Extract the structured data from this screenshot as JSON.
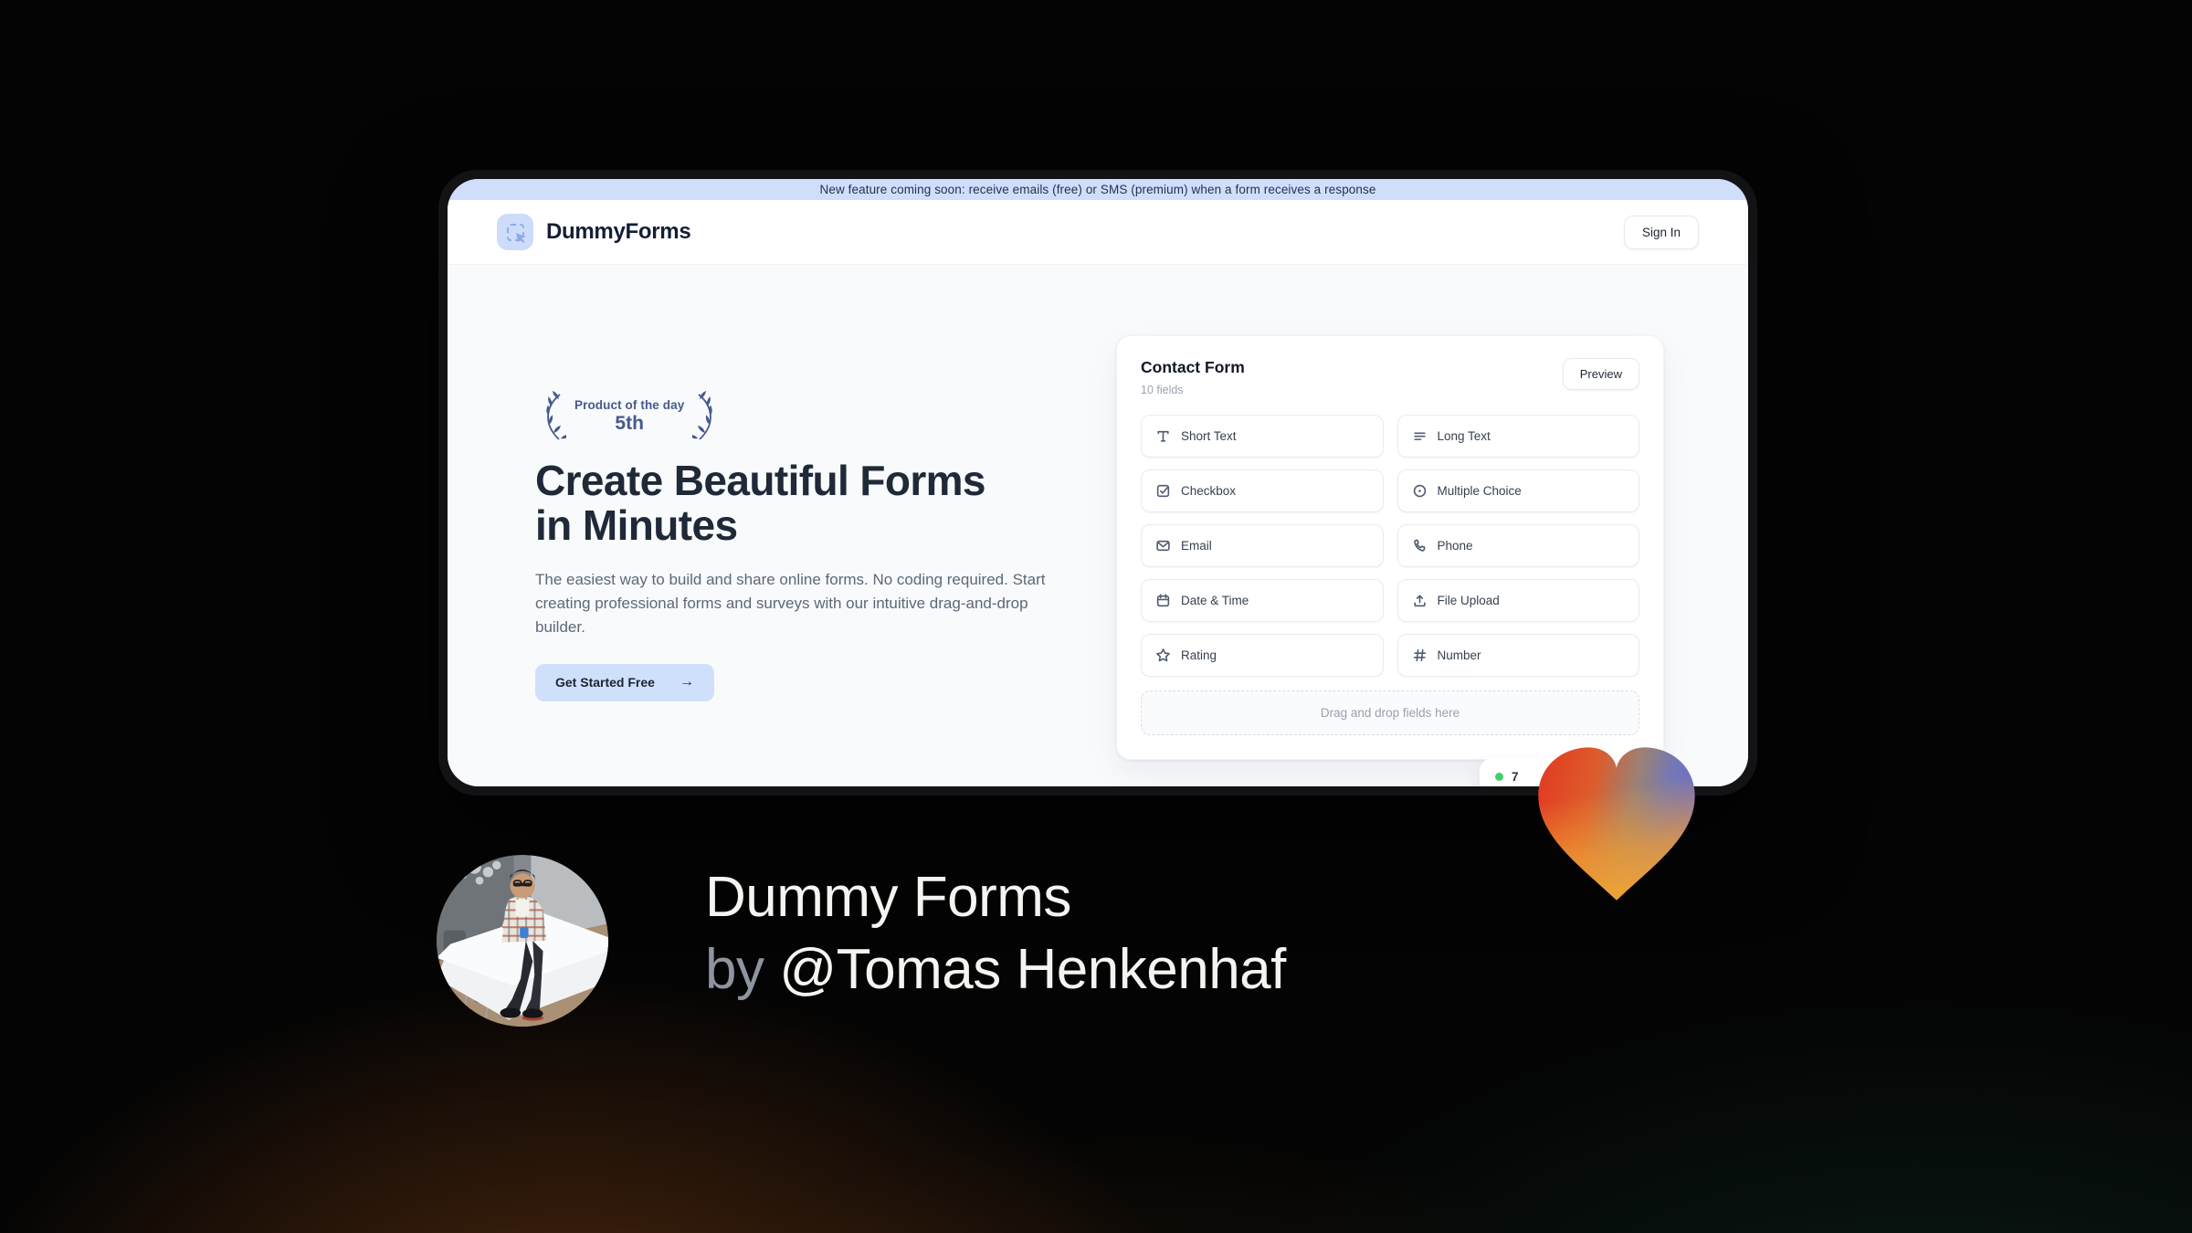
{
  "banner": {
    "text": "New feature coming soon: receive emails (free) or SMS (premium) when a form receives a response"
  },
  "header": {
    "brand": "DummyForms",
    "sign_in_label": "Sign In"
  },
  "hero": {
    "product_badge": {
      "line1": "Product of the day",
      "line2": "5th"
    },
    "title": "Create Beautiful Forms in Minutes",
    "description": "The easiest way to build and share online forms. No coding required. Start creating professional forms and surveys with our intuitive drag-and-drop builder.",
    "cta_label": "Get Started Free",
    "cta_arrow": "→"
  },
  "form_card": {
    "title": "Contact Form",
    "subtitle": "10 fields",
    "preview_label": "Preview",
    "fields": [
      {
        "label": "Short Text",
        "icon": "text-icon"
      },
      {
        "label": "Long Text",
        "icon": "lines-icon"
      },
      {
        "label": "Checkbox",
        "icon": "checkbox-icon"
      },
      {
        "label": "Multiple Choice",
        "icon": "radio-icon"
      },
      {
        "label": "Email",
        "icon": "envelope-icon"
      },
      {
        "label": "Phone",
        "icon": "phone-icon"
      },
      {
        "label": "Date & Time",
        "icon": "calendar-icon"
      },
      {
        "label": "File Upload",
        "icon": "upload-icon"
      },
      {
        "label": "Rating",
        "icon": "star-icon"
      },
      {
        "label": "Number",
        "icon": "hash-icon"
      }
    ],
    "dropzone_text": "Drag and drop fields here",
    "responses_badge": {
      "text": "7"
    }
  },
  "caption": {
    "line1": "Dummy Forms",
    "by": "by",
    "author": "@Tomas Henkenhaf"
  },
  "colors": {
    "accent_light_blue": "#cfe0fb",
    "banner_blue": "#cfdffb",
    "navy_text": "#1f2937",
    "laurel_navy": "#47598c",
    "green_dot": "#3fcf6f",
    "heart_red": "#e23b22",
    "heart_orange": "#f09b32",
    "heart_purple": "#6b6fc7"
  }
}
